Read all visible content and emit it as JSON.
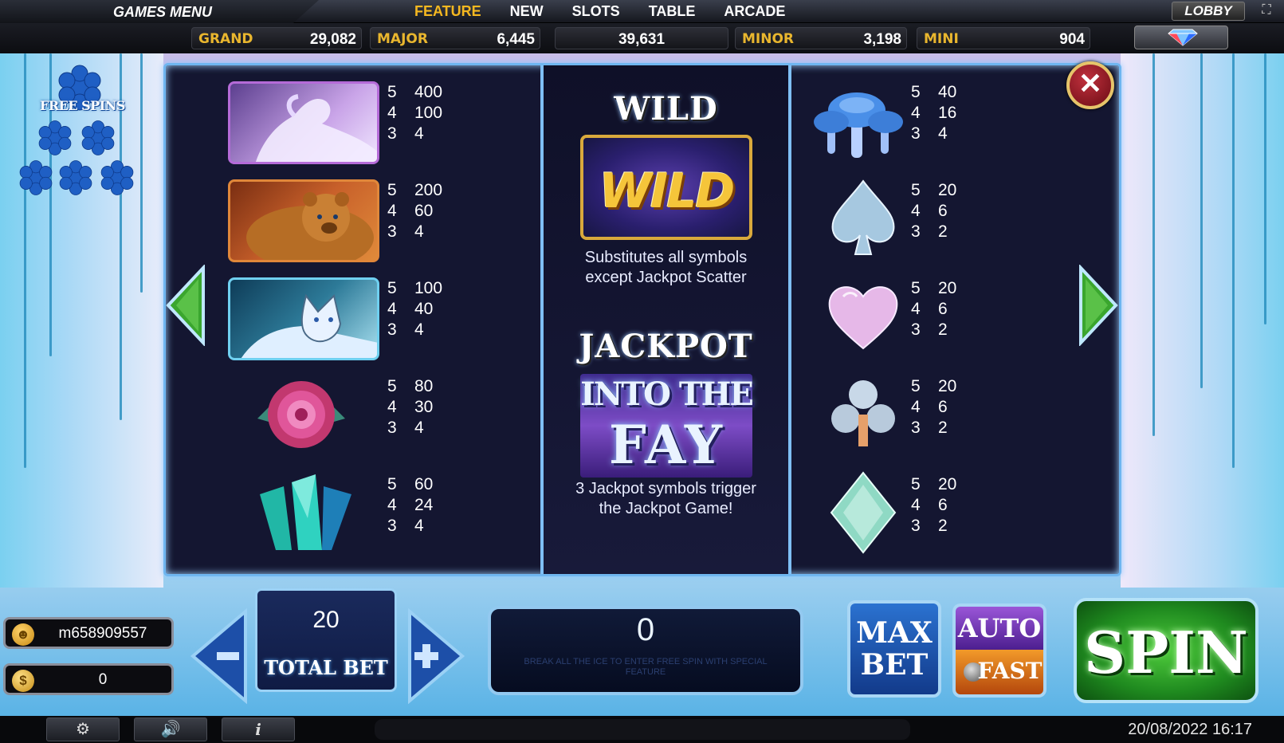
{
  "topbar": {
    "games_menu": "GAMES MENU",
    "tabs": [
      {
        "label": "FEATURE",
        "active": true
      },
      {
        "label": "NEW",
        "active": false
      },
      {
        "label": "SLOTS",
        "active": false
      },
      {
        "label": "TABLE",
        "active": false
      },
      {
        "label": "ARCADE",
        "active": false
      }
    ],
    "lobby": "LOBBY"
  },
  "jackpots": {
    "grand": {
      "label": "GRAND",
      "value": "29,082"
    },
    "major": {
      "label": "MAJOR",
      "value": "6,445"
    },
    "center": {
      "value": "39,631"
    },
    "minor": {
      "label": "MINOR",
      "value": "3,198"
    },
    "mini": {
      "label": "MINI",
      "value": "904"
    }
  },
  "free_spins": {
    "label": "FREE SPINS"
  },
  "paytable": {
    "left": [
      {
        "symbol": "white-horse",
        "pays": [
          [
            "5",
            "400"
          ],
          [
            "4",
            "100"
          ],
          [
            "3",
            "4"
          ]
        ]
      },
      {
        "symbol": "bear",
        "pays": [
          [
            "5",
            "200"
          ],
          [
            "4",
            "60"
          ],
          [
            "3",
            "4"
          ]
        ]
      },
      {
        "symbol": "wolf",
        "pays": [
          [
            "5",
            "100"
          ],
          [
            "4",
            "40"
          ],
          [
            "3",
            "4"
          ]
        ]
      },
      {
        "symbol": "rose",
        "pays": [
          [
            "5",
            "80"
          ],
          [
            "4",
            "30"
          ],
          [
            "3",
            "4"
          ]
        ]
      },
      {
        "symbol": "crystal",
        "pays": [
          [
            "5",
            "60"
          ],
          [
            "4",
            "24"
          ],
          [
            "3",
            "4"
          ]
        ]
      }
    ],
    "right": [
      {
        "symbol": "mushroom",
        "pays": [
          [
            "5",
            "40"
          ],
          [
            "4",
            "16"
          ],
          [
            "3",
            "4"
          ]
        ]
      },
      {
        "symbol": "ice-spade",
        "pays": [
          [
            "5",
            "20"
          ],
          [
            "4",
            "6"
          ],
          [
            "3",
            "2"
          ]
        ]
      },
      {
        "symbol": "ice-heart",
        "pays": [
          [
            "5",
            "20"
          ],
          [
            "4",
            "6"
          ],
          [
            "3",
            "2"
          ]
        ]
      },
      {
        "symbol": "ice-club",
        "pays": [
          [
            "5",
            "20"
          ],
          [
            "4",
            "6"
          ],
          [
            "3",
            "2"
          ]
        ]
      },
      {
        "symbol": "ice-diamond",
        "pays": [
          [
            "5",
            "20"
          ],
          [
            "4",
            "6"
          ],
          [
            "3",
            "2"
          ]
        ]
      }
    ],
    "center": {
      "wild_title": "WILD",
      "wild_logo": "WILD",
      "wild_desc_1": "Substitutes all symbols",
      "wild_desc_2": "except Jackpot Scatter",
      "jackpot_title": "JACKPOT",
      "jackpot_logo_1": "INTO THE",
      "jackpot_logo_2": "FAY",
      "jackpot_desc_1": "3 Jackpot symbols trigger",
      "jackpot_desc_2": "the Jackpot Game!"
    }
  },
  "player": {
    "username": "m658909557",
    "balance": "0",
    "coin_symbol": "$"
  },
  "bet": {
    "value": "20",
    "label": "TOTAL BET"
  },
  "win": {
    "value": "0",
    "hint": "BREAK ALL THE ICE TO ENTER FREE SPIN WITH SPECIAL FEATURE"
  },
  "buttons": {
    "max_bet_1": "MAX",
    "max_bet_2": "BET",
    "auto": "AUTO",
    "fast": "FAST",
    "spin": "SPIN"
  },
  "footer": {
    "info": "i",
    "datetime": "20/08/2022 16:17"
  },
  "colors": {
    "accent": "#f5b820",
    "jackpot_label": "#e9b62e",
    "panel_border": "#6fb6f0",
    "spin_green": "#1f8a1f"
  }
}
